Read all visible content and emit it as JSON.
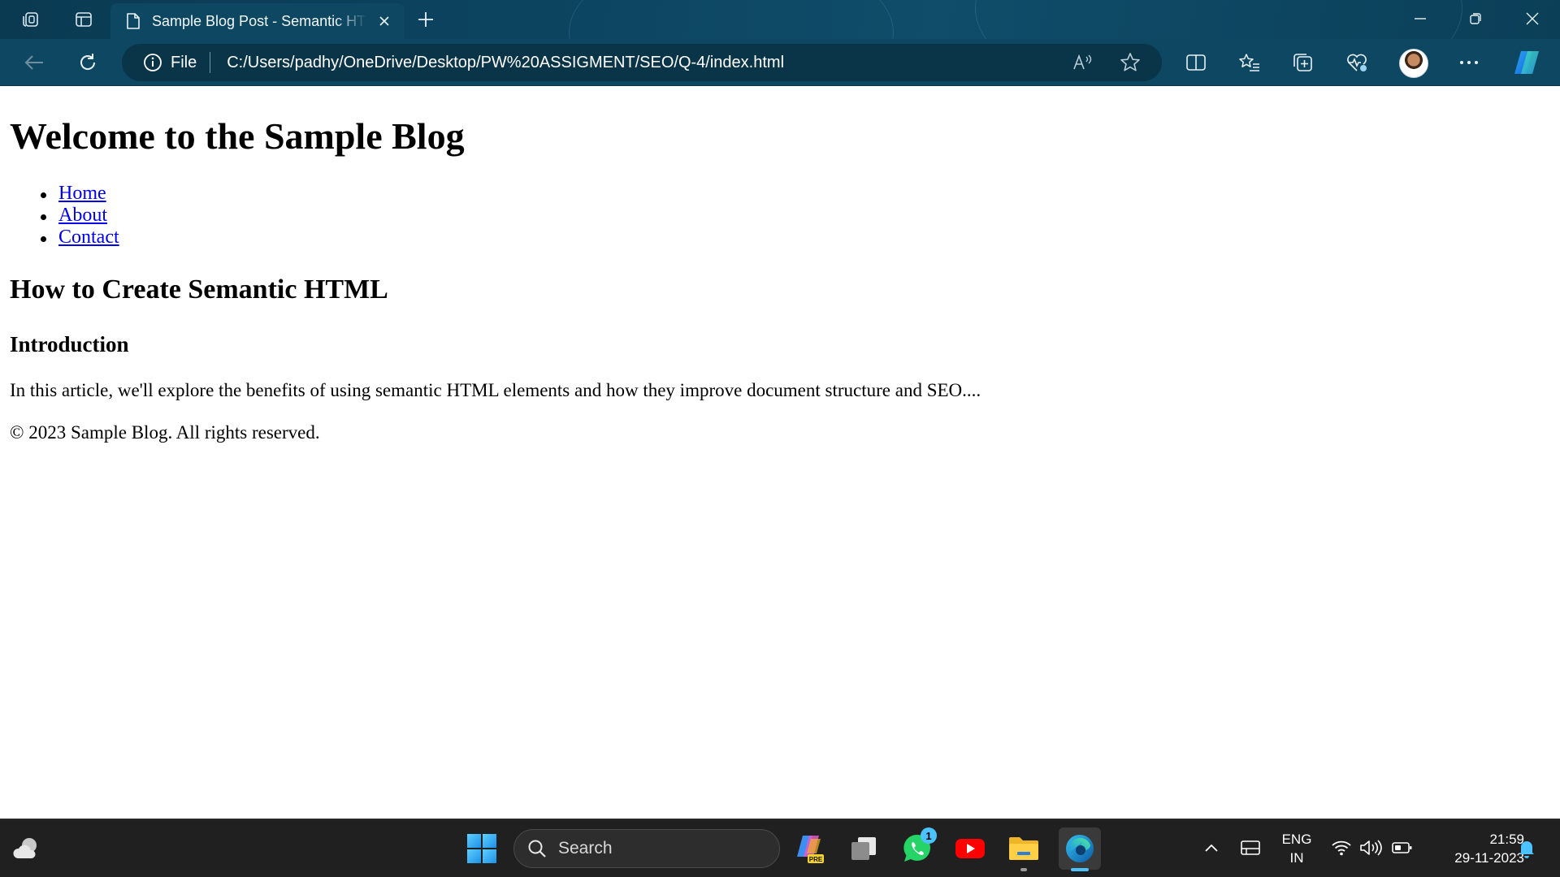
{
  "browser": {
    "tab": {
      "title": "Sample Blog Post - Semantic HTML"
    },
    "address_bar": {
      "site_label": "File",
      "url": "C:/Users/padhy/OneDrive/Desktop/PW%20ASSIGMENT/SEO/Q-4/index.html"
    },
    "icons": {
      "workspaces": "workspaces-icon",
      "vertical_tabs": "tab-actions-icon",
      "tab_page": "document-icon",
      "tab_close": "close-icon",
      "new_tab": "plus-icon",
      "back": "back-arrow-icon",
      "refresh": "refresh-icon",
      "site_info": "info-icon",
      "read_aloud": "read-aloud-icon",
      "favorite": "star-icon",
      "split_screen": "split-screen-icon",
      "favorites": "favorites-list-icon",
      "collections": "collections-icon",
      "performance": "heartbeat-icon",
      "profile": "profile-avatar",
      "more": "ellipsis-icon",
      "copilot": "copilot-icon"
    }
  },
  "page": {
    "heading": "Welcome to the Sample Blog",
    "nav": [
      {
        "label": "Home"
      },
      {
        "label": "About"
      },
      {
        "label": "Contact"
      }
    ],
    "article_title": "How to Create Semantic HTML",
    "section_title": "Introduction",
    "intro_text": "In this article, we'll explore the benefits of using semantic HTML elements and how they improve document structure and SEO....",
    "footer_text": "© 2023 Sample Blog. All rights reserved."
  },
  "taskbar": {
    "search_label": "Search",
    "whatsapp_badge": "1",
    "language": {
      "line1": "ENG",
      "line2": "IN"
    },
    "time": "21:59",
    "date": "29-11-2023",
    "colors": {
      "accent": "#4cc2ff",
      "edge_active": "#4cc2ff"
    }
  }
}
